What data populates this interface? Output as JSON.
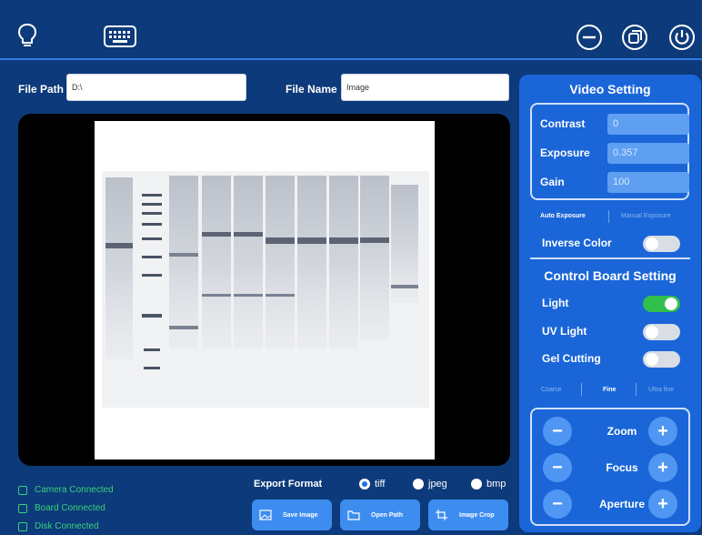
{
  "icons": {
    "bulb": "lightbulb-icon",
    "keyboard": "keyboard-icon",
    "minimize": "minimize-icon",
    "restore": "restore-icon",
    "power": "power-icon"
  },
  "file": {
    "path_label": "File Path",
    "path_value": "D:\\",
    "name_label": "File Name",
    "name_value": "Image"
  },
  "status": {
    "camera": "Camera Connected",
    "board": "Board Connected",
    "disk": "Disk Connected"
  },
  "export": {
    "label": "Export Format",
    "options": [
      "tiff",
      "jpeg",
      "bmp"
    ],
    "selected": "tiff"
  },
  "actions": {
    "save": "Save Image",
    "open": "Open Path",
    "crop": "Image Crop"
  },
  "video": {
    "title": "Video Setting",
    "contrast_label": "Contrast",
    "contrast_value": "0",
    "exposure_label": "Exposure",
    "exposure_value": "0.357",
    "gain_label": "Gain",
    "gain_value": "100",
    "auto_exposure": "Auto Exposure",
    "manual_exposure": "Manual Exposure",
    "inverse_label": "Inverse Color",
    "inverse_on": false
  },
  "control": {
    "title": "Control Board Setting",
    "light_label": "Light",
    "light_on": true,
    "uv_label": "UV Light",
    "uv_on": false,
    "gel_label": "Gel Cutting",
    "gel_on": false,
    "speed": [
      "Coarse",
      "Fine",
      "Ultra fine"
    ],
    "speed_selected": "Fine",
    "zoom_label": "Zoom",
    "focus_label": "Focus",
    "aperture_label": "Aperture"
  },
  "colors": {
    "background": "#0d3a7a",
    "panel": "#1a66d8",
    "accent": "#3d8cf0",
    "status_green": "#36d27a",
    "toggle_on": "#2fbf4a"
  }
}
